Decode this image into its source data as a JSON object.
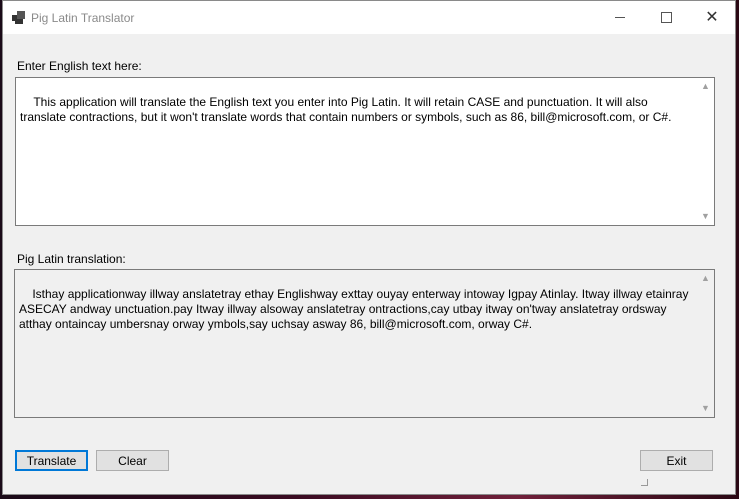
{
  "window": {
    "title": "Pig Latin Translator"
  },
  "input": {
    "label": "Enter English text here:",
    "value": "This application will translate the English text you enter into Pig Latin. It will retain CASE and punctuation. It will also translate contractions, but it won't translate words that contain numbers or symbols, such as 86, bill@microsoft.com, or C#."
  },
  "output": {
    "label": "Pig Latin translation:",
    "value": "Isthay applicationway illway anslatetray ethay Englishway exttay ouyay enterway intoway Igpay Atinlay. Itway illway etainray ASECAY andway unctuation.pay Itway illway alsoway anslatetray ontractions,cay utbay itway on'tway anslatetray ordsway atthay ontaincay umbersnay orway ymbols,say uchsay asway 86, bill@microsoft.com, orway C#."
  },
  "buttons": {
    "translate": "Translate",
    "clear": "Clear",
    "exit": "Exit"
  },
  "icons": {
    "app": "app-window-icon",
    "minimize": "minimize-icon",
    "maximize": "maximize-icon",
    "close": "close-icon"
  }
}
